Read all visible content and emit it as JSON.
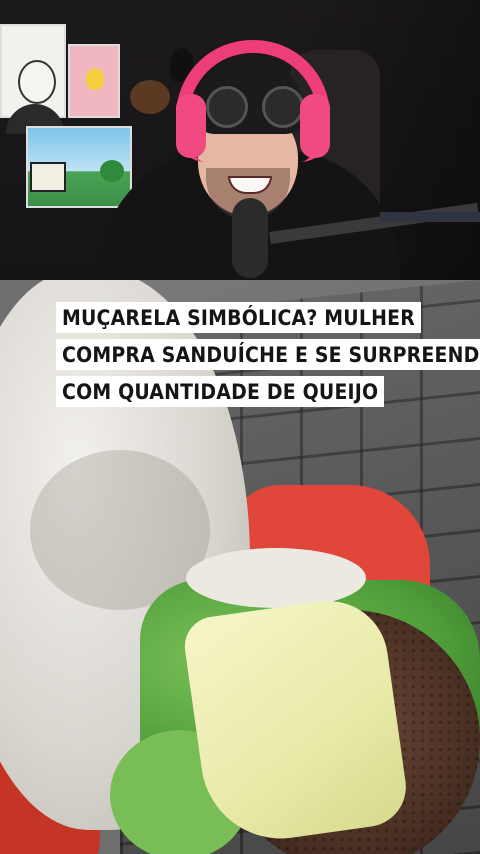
{
  "caption": {
    "lines": [
      "MUÇARELA SIMBÓLICA? MULHER",
      "COMPRA SANDUÍCHE E SE SURPREENDE",
      "COM QUANTIDADE DE QUEIJO"
    ]
  },
  "colors": {
    "headphones": "#ee3e78",
    "caption_bg": "#ffffff",
    "caption_text": "#151515",
    "cheese": "#e8eaa8",
    "lettuce": "#4f9e3a"
  }
}
